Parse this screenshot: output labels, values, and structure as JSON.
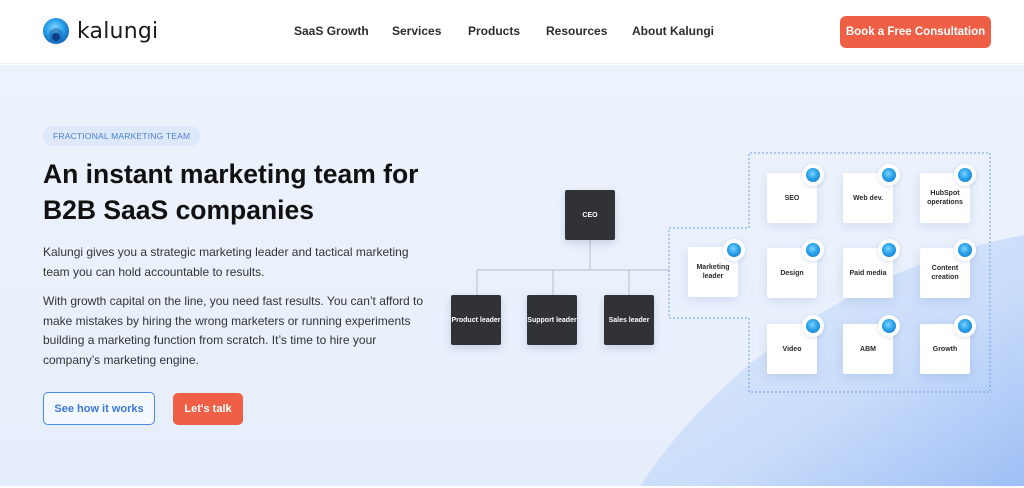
{
  "brand": {
    "name": "kalungi",
    "accent": "#ef5f45",
    "blue": "#2a9fe6"
  },
  "nav": {
    "items": [
      {
        "label": "SaaS Growth"
      },
      {
        "label": "Services"
      },
      {
        "label": "Products"
      },
      {
        "label": "Resources"
      },
      {
        "label": "About Kalungi"
      }
    ],
    "cta_label": "Book a Free Consultation"
  },
  "hero": {
    "eyebrow": "FRACTIONAL MARKETING TEAM",
    "headline": "An instant marketing team for B2B SaaS companies",
    "para1": "Kalungi gives you a strategic marketing leader and tactical marketing team you can hold accountable to results.",
    "para2": "With growth capital on the line, you need fast results. You can’t afford to make mistakes by hiring the wrong marketers or running experiments building a marketing function from scratch. It’s time to hire your company’s marketing engine.",
    "btn_outline_label": "See how it works",
    "btn_solid_label": "Let's talk"
  },
  "org_chart": {
    "ceo": "CEO",
    "leaders": [
      "Product leader",
      "Support leader",
      "Sales leader"
    ],
    "marketing_leader": "Marketing leader",
    "team": [
      "SEO",
      "Web dev.",
      "HubSpot operations",
      "Design",
      "Paid media",
      "Content creation",
      "Video",
      "ABM",
      "Growth"
    ]
  }
}
